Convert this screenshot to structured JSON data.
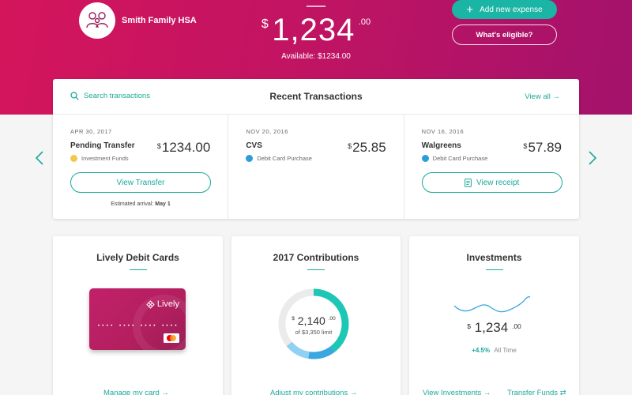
{
  "account": {
    "name": "Smith Family HSA",
    "avatar_icon": "family-icon"
  },
  "balance": {
    "currency": "$",
    "amount": "1,234",
    "cents": ".00",
    "available": "Available: $1234.00"
  },
  "actions": {
    "add_expense": "Add new expense",
    "whats_eligible": "What's eligible?"
  },
  "transactions": {
    "search_label": "Search transactions",
    "title": "Recent Transactions",
    "view_all": "View all",
    "items": [
      {
        "date": "APR 30, 2017",
        "merchant": "Pending Transfer",
        "currency": "$",
        "amount": "1234.00",
        "category": "Investment Funds",
        "category_color": "#f2c94c",
        "button": "View Transfer",
        "note_prefix": "Estimated arrival: ",
        "note_value": "May 1"
      },
      {
        "date": "NOV 20, 2016",
        "merchant": "CVS",
        "currency": "$",
        "amount": "25.85",
        "category": "Debit Card Purchase",
        "category_color": "#2d9cdb"
      },
      {
        "date": "NOV 16, 2016",
        "merchant": "Walgreens",
        "currency": "$",
        "amount": "57.89",
        "category": "Debit Card Purchase",
        "category_color": "#2d9cdb",
        "button": "View receipt",
        "button_icon": "receipt-icon"
      }
    ]
  },
  "cards": {
    "debit": {
      "title": "Lively Debit Cards",
      "brand": "Lively",
      "card_number": "•••• •••• •••• ••••",
      "link": "Manage my card"
    },
    "contributions": {
      "title": "2017 Contributions",
      "currency": "$",
      "amount": "2,140",
      "cents": ".00",
      "limit": "of $3,350 limit",
      "contributed": 2140,
      "total_limit": 3350,
      "link": "Adjust my contributions"
    },
    "investments": {
      "title": "Investments",
      "currency": "$",
      "amount": "1,234",
      "cents": ".00",
      "change": "+4.5%",
      "change_label": "All Time",
      "link_investments": "View Investments",
      "link_transfer": "Transfer Funds"
    }
  },
  "colors": {
    "brand_start": "#d4155c",
    "brand_end": "#a3126b",
    "accent": "#1aa99b"
  }
}
